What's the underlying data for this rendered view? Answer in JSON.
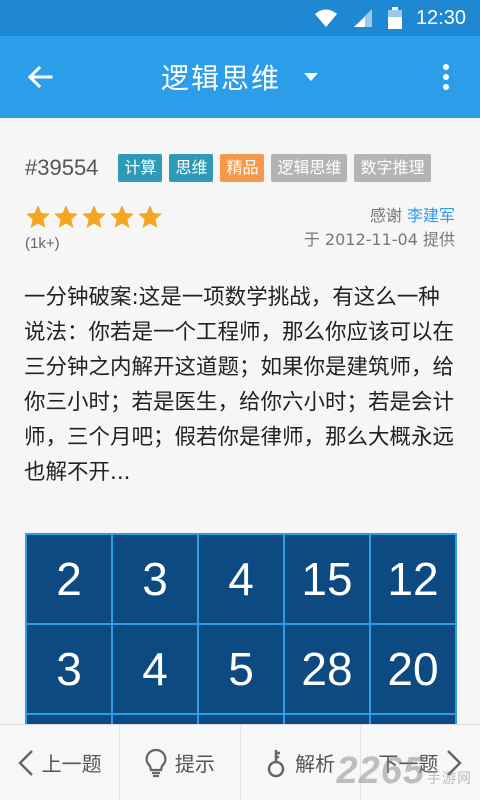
{
  "status_bar": {
    "time": "12:30"
  },
  "app_bar": {
    "title": "逻辑思维"
  },
  "question": {
    "id": "#39554",
    "tags": [
      {
        "label": "计算",
        "color": "#2e9ab5"
      },
      {
        "label": "思维",
        "color": "#2e9ab5"
      },
      {
        "label": "精品",
        "color": "#f59a4a"
      },
      {
        "label": "逻辑思维",
        "color": "#b4b4b4"
      },
      {
        "label": "数字推理",
        "color": "#b4b4b4"
      }
    ],
    "rating": 5,
    "rating_max": 5,
    "rating_count": "(1k+)",
    "credit_prefix": "感谢",
    "author": "李建军",
    "provided": "于 2012-11-04 提供",
    "text": "一分钟破案:这是一项数学挑战，有这么一种说法：你若是一个工程师，那么你应该可以在三分钟之内解开这道题；如果你是建筑师，给你三小时；若是医生，给你六小时；若是会计师，三个月吧；假若你是律师，那么大概永远也解不开...",
    "grid": [
      [
        "2",
        "3",
        "4",
        "15",
        "12"
      ],
      [
        "3",
        "4",
        "5",
        "28",
        "20"
      ]
    ]
  },
  "bottom_bar": {
    "prev": "上一题",
    "hint": "提示",
    "analysis": "解析",
    "next": "下一题"
  },
  "watermark": {
    "brand": "2265",
    "suffix": "手游网"
  },
  "colors": {
    "status_bar": "#1e88d3",
    "app_bar": "#2c9de8",
    "grid_cell": "#0d4a82",
    "star": "#f5a623"
  }
}
